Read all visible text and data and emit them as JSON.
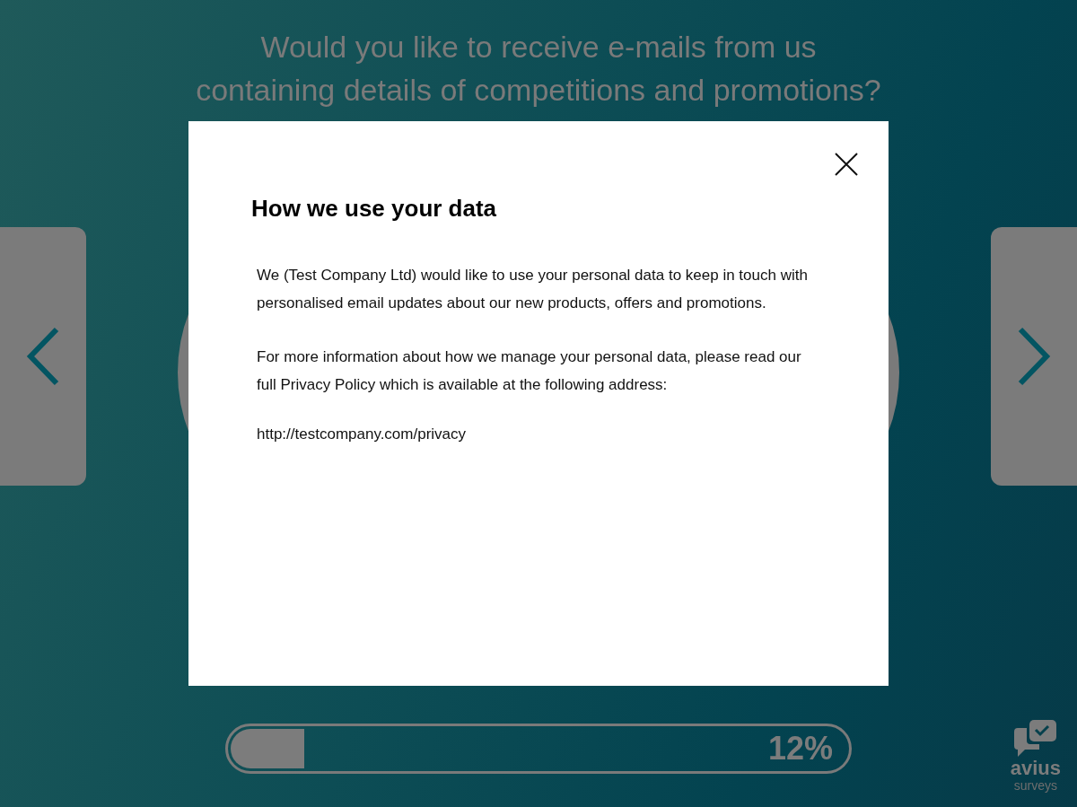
{
  "question": {
    "lines": [
      "Would you like to receive e-mails from us",
      "containing details of competitions and promotions?"
    ]
  },
  "progress": {
    "level": 0.12,
    "reading": "12%"
  },
  "logo": {
    "name": "avius",
    "tagline": "surveys"
  },
  "dialog": {
    "title": "How we use your data",
    "paragraphs": [
      "We (Test Company Ltd) would like to use your personal data to keep in touch with personalised email updates about our new products, offers and promotions.",
      "For more information about how we manage your personal data, please read our full Privacy Policy which is available at the following address:"
    ],
    "link": "http://testcompany.com/privacy"
  }
}
